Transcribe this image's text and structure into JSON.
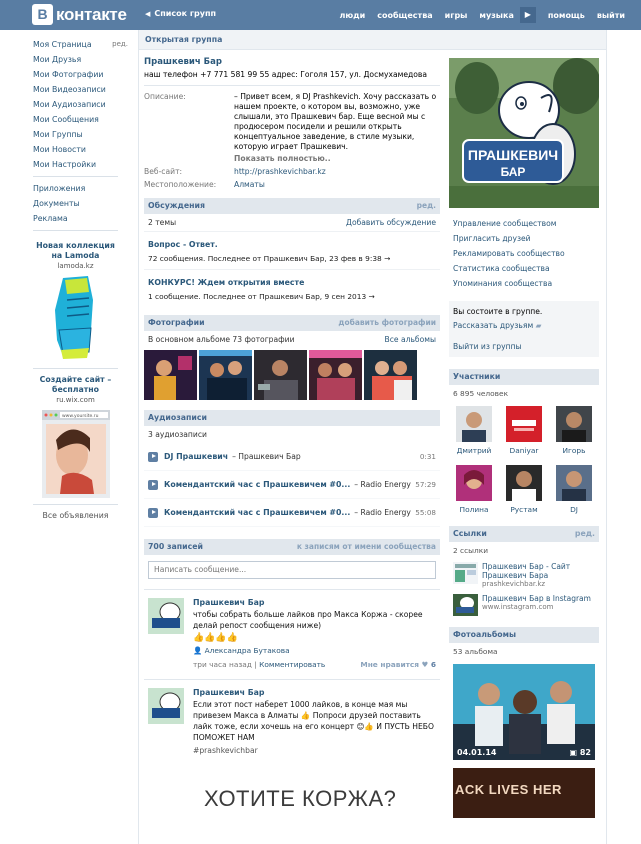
{
  "header": {
    "logo_letter": "В",
    "logo_text": "контакте",
    "group_list": "Список групп",
    "nav": [
      "люди",
      "сообщества",
      "игры",
      "музыка",
      "помощь",
      "выйти"
    ]
  },
  "sidebar": {
    "edit_label": "ред.",
    "items": [
      "Моя Страница",
      "Мои Друзья",
      "Мои Фотографии",
      "Мои Видеозаписи",
      "Мои Аудиозаписи",
      "Мои Сообщения",
      "Мои Группы",
      "Мои Новости",
      "Мои Настройки"
    ],
    "items2": [
      "Приложения",
      "Документы",
      "Реклама"
    ],
    "ad1": {
      "title": "Новая коллекция на Lamoda",
      "sub": "lamoda.kz"
    },
    "ad2": {
      "title": "Создайте сайт – бесплатно",
      "sub": "ru.wix.com",
      "browser_url": "www.yoursite.ru"
    },
    "all_ads": "Все объявления"
  },
  "breadcrumb": "Открытая группа",
  "group": {
    "name": "Прашкевич Бар",
    "status": "наш телефон +7 771 581 99 55 адрес: Гоголя 157, ул. Досмухамедова",
    "description_label": "Описание:",
    "description": "– Привет всем, я DJ Prashkevich. Хочу рассказать о нашем проекте, о котором вы, возможно, уже слышали, это Прашкевич бар. Еще весной мы с продюсером посидели и решили открыть концептуальное заведение, в стиле музыки, которую играет Прашкевич.",
    "show_full": "Показать полностью..",
    "website_label": "Веб-сайт:",
    "website": "http://prashkevichbar.kz",
    "location_label": "Местоположение:",
    "location": "Алматы"
  },
  "discussions": {
    "title": "Обсуждения",
    "edit": "ред.",
    "count": "2 темы",
    "add": "Добавить обсуждение",
    "topics": [
      {
        "title": "Вопрос - Ответ.",
        "meta": "72 сообщения. Последнее от Прашкевич Бар, 23 фев в 9:38"
      },
      {
        "title": "КОНКУРС! Ждем открытия вместе",
        "meta": "1 сообщение. Последнее от Прашкевич Бар, 9 сен 2013"
      }
    ]
  },
  "photos": {
    "title": "Фотографии",
    "add": "добавить фотографии",
    "count": "В основном альбоме 73 фотографии",
    "all": "Все альбомы"
  },
  "audio": {
    "title": "Аудиозаписи",
    "count": "3 аудиозаписи",
    "tracks": [
      {
        "artist": "DJ Прашкевич",
        "title": "– Прашкевич Бар",
        "duration": "0:31"
      },
      {
        "artist": "Комендантский час с Прашкевичем #0...",
        "title": "– Radio Energy F...",
        "duration": "57:29"
      },
      {
        "artist": "Комендантский час с Прашкевичем #0...",
        "title": "– Radio Energy F...",
        "duration": "55:08"
      }
    ]
  },
  "wall": {
    "count": "700 записей",
    "to_posts": "к записям от имени сообщества",
    "placeholder": "Написать сообщение...",
    "posts": [
      {
        "author": "Прашкевич Бар",
        "text": "чтобы собрать больше лайков про Макса Коржа - скорее делай репост сообщения ниже)",
        "reposter": "Александра Бутакова",
        "time": "три часа назад",
        "comment": "Комментировать",
        "likes_label": "Мне нравится",
        "likes": "6"
      },
      {
        "author": "Прашкевич Бар",
        "text": "Если этот пост наберет 1000 лайков, в конце мая мы привезем Макса в Алматы 👍 Попроси друзей поставить лайк тоже, если хочешь на его концерт 😊👍 И ПУСТЬ НЕБО ПОМОЖЕТ НАМ",
        "hashtag": "#prashkevichbar"
      }
    ],
    "banner": "ХОТИТЕ КОРЖА?"
  },
  "side": {
    "cover_sign_top": "ПРАШКЕВИЧ",
    "cover_sign_bottom": "БАР",
    "links": [
      "Управление сообществом",
      "Пригласить друзей",
      "Рекламировать сообщество",
      "Статистика сообщества",
      "Упоминания сообщества"
    ],
    "member_status": "Вы состоите в группе.",
    "tell_friends": "Рассказать друзьям",
    "leave": "Выйти из группы",
    "members_title": "Участники",
    "members_count": "6 895 человек",
    "members": [
      "Дмитрий",
      "Daniyar",
      "Игорь",
      "Полина",
      "Рустам",
      "DJ"
    ],
    "links_title": "Ссылки",
    "links_edit": "ред.",
    "links_count": "2 ссылки",
    "ext_links": [
      {
        "title": "Прашкевич Бар - Сайт Прашкевич Бара",
        "url": "prashkevichbar.kz"
      },
      {
        "title": "Прашкевич Бар в Instagram",
        "url": "www.instagram.com"
      }
    ],
    "albums_title": "Фотоальбомы",
    "albums_count": "53 альбома",
    "album1_date": "04.01.14",
    "album1_count": "82",
    "album2_text": "ACK LIVES HER"
  }
}
